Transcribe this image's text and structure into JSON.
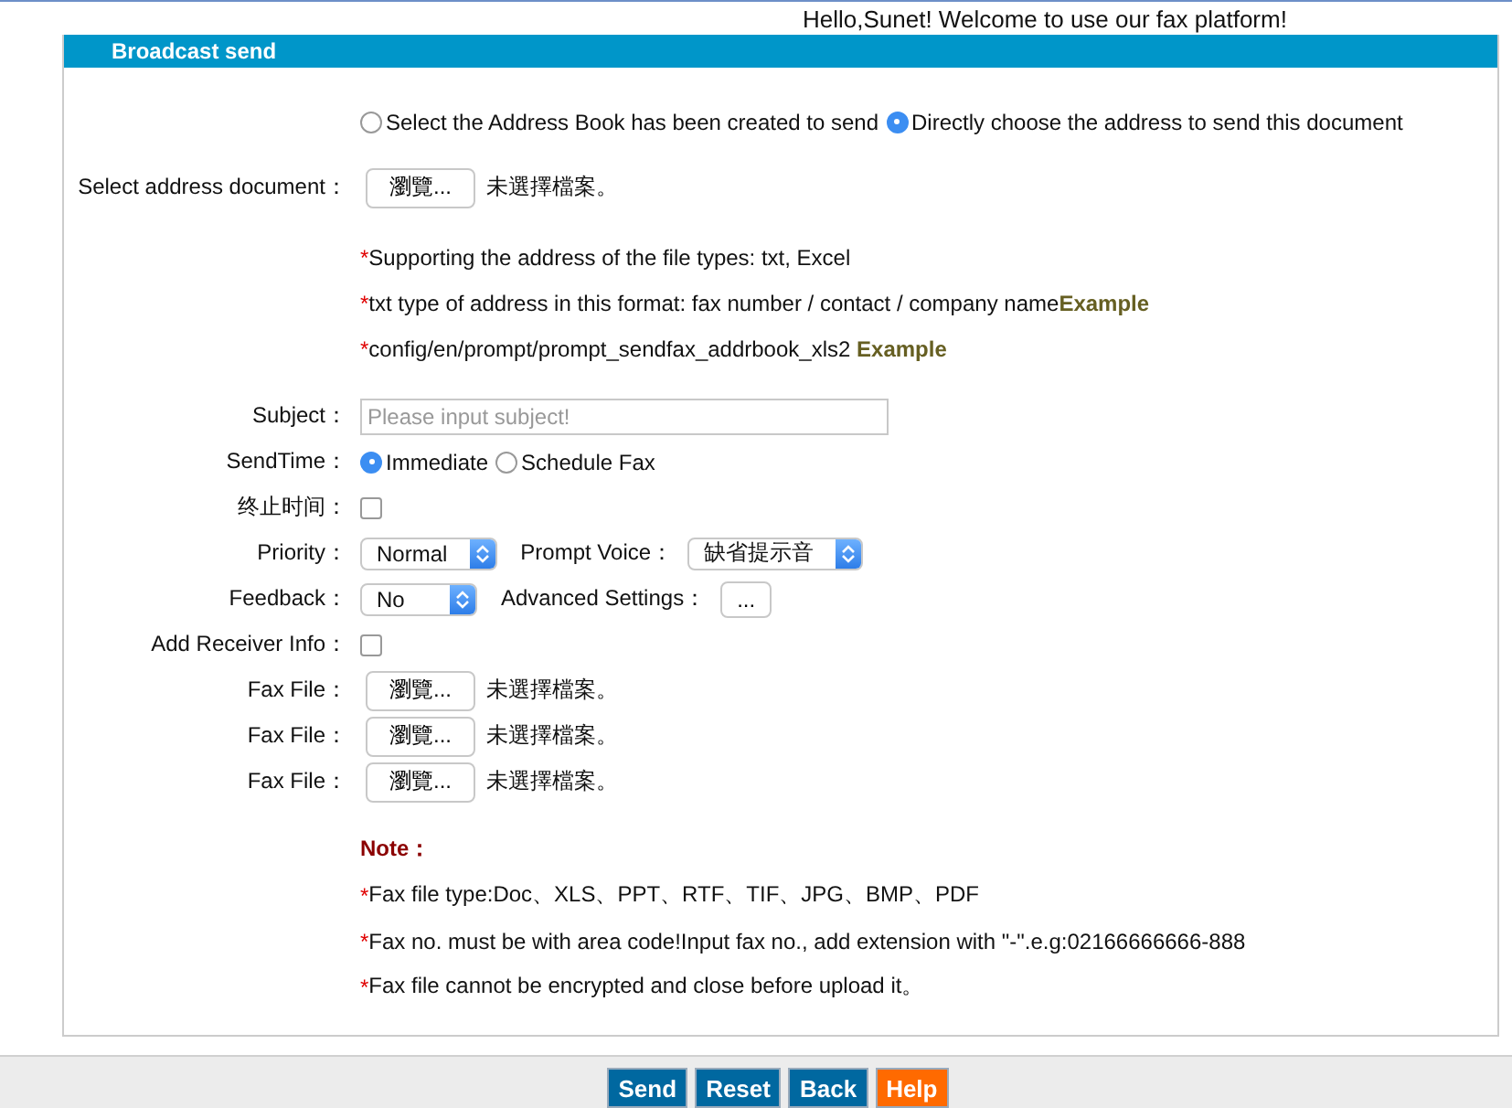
{
  "greeting": "Hello,Sunet! Welcome to use our fax platform!",
  "panel": {
    "title": "Broadcast send",
    "address_mode": [
      {
        "label": "Select the Address Book has been created to send",
        "selected": false
      },
      {
        "label": "Directly choose the address to send this document",
        "selected": true
      }
    ],
    "address_document": {
      "label": "Select address document：",
      "button": "瀏覽...",
      "status": "未選擇檔案。"
    },
    "address_notes": [
      {
        "marker": "*",
        "text": "Supporting the address of the file types: txt, Excel"
      },
      {
        "marker": "*",
        "text": "txt type of address in this format: fax number / contact / company name**Example**"
      },
      {
        "marker": "*",
        "text": "config/en/prompt/prompt_sendfax_addrbook_xls2 **Example**"
      }
    ],
    "rows": [
      {
        "label": "Subject：",
        "controls": [
          {
            "kind": "input",
            "placeholder": "Please input subject!"
          }
        ]
      },
      {
        "label": "SendTime：",
        "controls": [
          {
            "kind": "radio",
            "label": "Immediate",
            "selected": true
          },
          {
            "kind": "radio",
            "label": "Schedule Fax",
            "selected": false
          }
        ]
      },
      {
        "label": "终止时间：",
        "controls": [
          {
            "kind": "checkbox",
            "checked": false
          }
        ]
      },
      {
        "label": "Priority：",
        "controls": [
          {
            "kind": "select",
            "value": "Normal"
          },
          {
            "kind": "text",
            "text": "Prompt Voice："
          },
          {
            "kind": "select",
            "value": "缺省提示音"
          }
        ]
      },
      {
        "label": "Feedback：",
        "controls": [
          {
            "kind": "select",
            "value": "No"
          },
          {
            "kind": "text",
            "text": "Advanced Settings："
          },
          {
            "kind": "button",
            "label": "..."
          }
        ]
      },
      {
        "label": "Add Receiver Info：",
        "controls": [
          {
            "kind": "checkbox",
            "checked": false
          }
        ]
      },
      {
        "label": "Fax File：",
        "controls": [
          {
            "kind": "file",
            "button": "瀏覽...",
            "status": "未選擇檔案。"
          }
        ]
      },
      {
        "label": "Fax File：",
        "controls": [
          {
            "kind": "file",
            "button": "瀏覽...",
            "status": "未選擇檔案。"
          }
        ]
      },
      {
        "label": "Fax File：",
        "controls": [
          {
            "kind": "file",
            "button": "瀏覽...",
            "status": "未選擇檔案。"
          }
        ]
      }
    ],
    "note_title": "Note：",
    "notes": [
      {
        "marker": "*",
        "text": "Fax file type:Doc、XLS、PPT、RTF、TIF、JPG、BMP、PDF"
      },
      {
        "marker": "*",
        "text": "Fax no. must be with area code!Input fax no., add extension with \"-\".e.g:02166666666-888"
      },
      {
        "marker": "*",
        "text": "Fax file cannot be encrypted and close before upload it。"
      }
    ]
  },
  "footer_buttons": [
    {
      "label": "Send",
      "kind": "primary"
    },
    {
      "label": "Reset",
      "kind": "primary"
    },
    {
      "label": "Back",
      "kind": "primary"
    },
    {
      "label": "Help",
      "kind": "help"
    }
  ]
}
